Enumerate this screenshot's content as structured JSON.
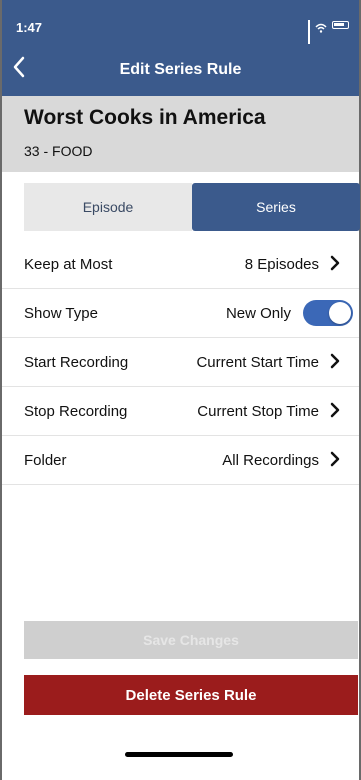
{
  "status_bar": {
    "time": "1:47",
    "icons": [
      "location-arrow-icon",
      "signal-icon",
      "wifi-icon",
      "battery-icon"
    ]
  },
  "nav": {
    "title": "Edit Series Rule",
    "back_icon": "chevron-left-icon"
  },
  "show": {
    "title": "Worst Cooks in America",
    "channel": "33 - FOOD"
  },
  "tabs": [
    {
      "label": "Episode",
      "active": false
    },
    {
      "label": "Series",
      "active": true
    }
  ],
  "settings": [
    {
      "label": "Keep at Most",
      "value": "8 Episodes"
    },
    {
      "label": "Show Type",
      "value": "New Only",
      "toggle_on": true
    },
    {
      "label": "Start Recording",
      "value": "Current Start Time"
    },
    {
      "label": "Stop Recording",
      "value": "Current Stop Time"
    },
    {
      "label": "Folder",
      "value": "All Recordings"
    }
  ],
  "actions": {
    "save_label": "Save Changes",
    "delete_label": "Delete Series Rule"
  },
  "colors": {
    "header": "#3b5a8c",
    "delete": "#9b1c1c",
    "toggle": "#3b68b7",
    "info_bg": "#d9d9d9"
  }
}
